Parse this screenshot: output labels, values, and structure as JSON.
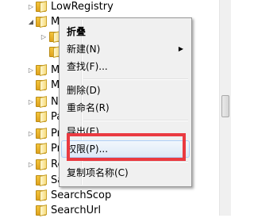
{
  "tree": {
    "items": [
      {
        "label": "LowRegistry",
        "expander": "▷"
      },
      {
        "label": "Mo",
        "expander": "◢"
      },
      {
        "label": "",
        "expander": ""
      },
      {
        "label": "",
        "expander": ""
      },
      {
        "label": "M",
        "expander": ""
      },
      {
        "label": "M",
        "expander": ""
      },
      {
        "label": "N",
        "expander": ""
      },
      {
        "label": "Pa",
        "expander": ""
      },
      {
        "label": "Pr",
        "expander": ""
      },
      {
        "label": "Pr",
        "expander": ""
      },
      {
        "label": "Re",
        "expander": ""
      },
      {
        "label": "Sa",
        "expander": ""
      },
      {
        "label": "SearchScop",
        "expander": ""
      },
      {
        "label": "SearchUrl",
        "expander": ""
      }
    ]
  },
  "context_menu": {
    "items": [
      {
        "label": "折叠",
        "bold": true
      },
      {
        "label": "新建(N)",
        "submenu_arrow": "▶"
      },
      {
        "label": "查找(F)..."
      },
      {
        "label": "删除(D)"
      },
      {
        "label": "重命名(R)"
      },
      {
        "label": "导出(E)"
      },
      {
        "label": "权限(P)..."
      },
      {
        "label": "复制项名称(C)"
      }
    ]
  },
  "colors": {
    "highlight_box": "#ea3a41",
    "menu_background": "#f0f0f0",
    "folder_yellow": "#f4c53c"
  }
}
